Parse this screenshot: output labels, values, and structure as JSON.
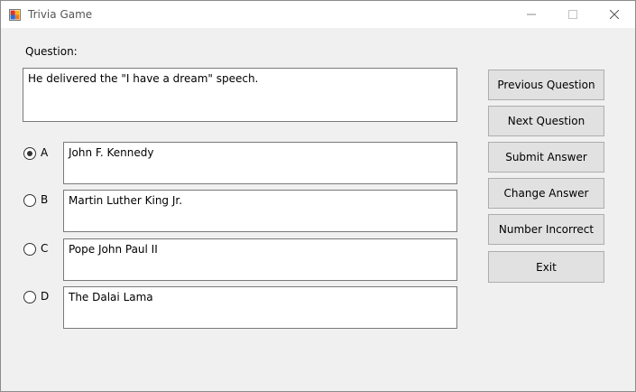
{
  "window": {
    "title": "Trivia Game",
    "icon": "windows-forms-app-icon",
    "controls": [
      "minimize-icon",
      "maximize-icon",
      "close-icon"
    ]
  },
  "question": {
    "label": "Question:",
    "text": "He delivered the \"I have a dream\" speech."
  },
  "answers": [
    {
      "letter": "A",
      "text": "John F. Kennedy",
      "selected": true
    },
    {
      "letter": "B",
      "text": "Martin Luther King Jr.",
      "selected": false
    },
    {
      "letter": "C",
      "text": "Pope John Paul II",
      "selected": false
    },
    {
      "letter": "D",
      "text": "The Dalai Lama",
      "selected": false
    }
  ],
  "buttons": {
    "previous": "Previous Question",
    "next": "Next Question",
    "submit": "Submit Answer",
    "change": "Change Answer",
    "incorrect": "Number Incorrect",
    "exit": "Exit"
  },
  "colors": {
    "window_bg": "#f0f0f0",
    "titlebar_bg": "#ffffff",
    "button_bg": "#e1e1e1",
    "button_border": "#adadad",
    "textbox_border": "#7a7a7a"
  }
}
